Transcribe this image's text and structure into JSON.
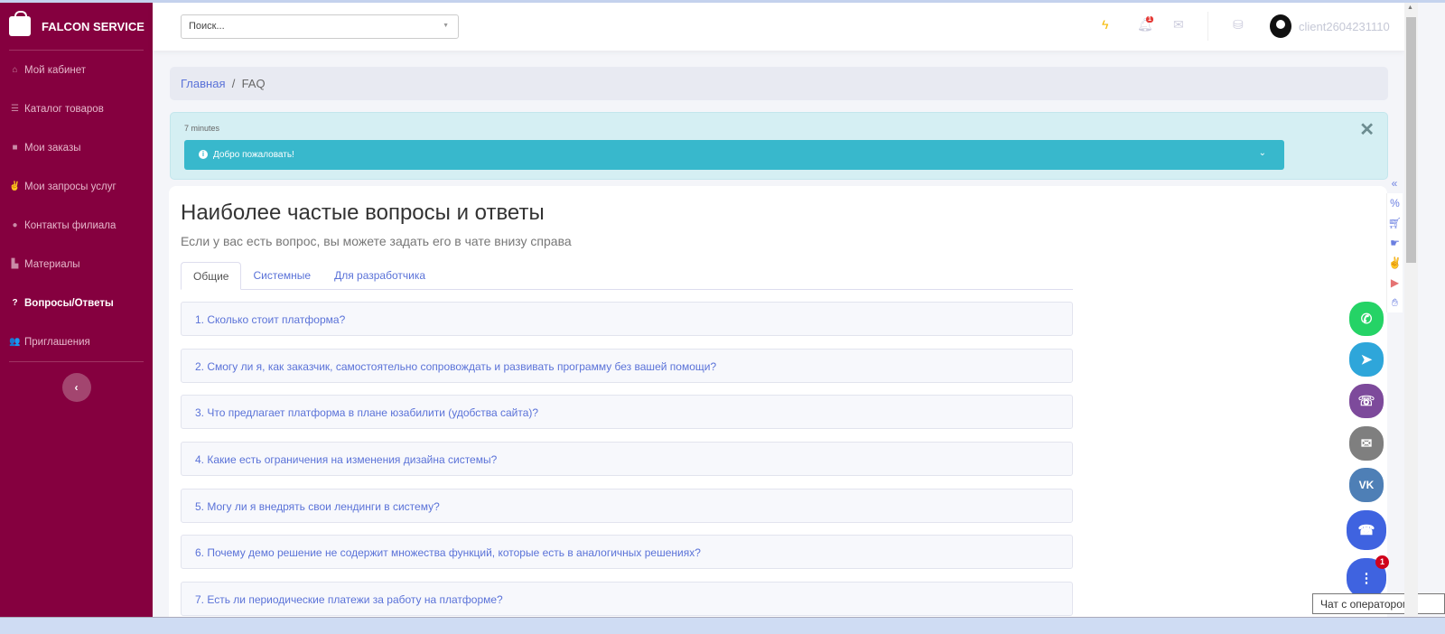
{
  "brand": "FALCON SERVICE",
  "sidebar": {
    "items": [
      {
        "label": "Мой кабинет",
        "icon": "home-icon"
      },
      {
        "label": "Каталог товаров",
        "icon": "list-icon"
      },
      {
        "label": "Мои заказы",
        "icon": "bag-icon"
      },
      {
        "label": "Мои запросы услуг",
        "icon": "hand-icon"
      },
      {
        "label": "Контакты филиала",
        "icon": "info-icon"
      },
      {
        "label": "Материалы",
        "icon": "materials-icon"
      },
      {
        "label": "Вопросы/Ответы",
        "icon": "question-icon",
        "active": true
      },
      {
        "label": "Приглашения",
        "icon": "users-icon"
      }
    ]
  },
  "header": {
    "search_placeholder": "Поиск...",
    "notifications_count": "1",
    "username": "client2604231110"
  },
  "breadcrumb": {
    "home": "Главная",
    "sep": "/",
    "current": "FAQ"
  },
  "alert": {
    "time": "7 minutes",
    "message": "Добро пожаловать!"
  },
  "main": {
    "title": "Наиболее частые вопросы и ответы",
    "subtitle": "Если у вас есть вопрос, вы можете задать его в чате внизу справа",
    "tabs": [
      "Общие",
      "Системные",
      "Для разработчика"
    ],
    "questions": [
      "1. Сколько стоит платформа?",
      "2. Смогу ли я, как заказчик, самостоятельно сопровождать и развивать программу без вашей помощи?",
      "3. Что предлагает платформа в плане юзабилити (удобства сайта)?",
      "4. Какие есть ограничения на изменения дизайна системы?",
      "5. Могу ли я внедрять свои лендинги в систему?",
      "6. Почему демо решение не содержит множества функций, которые есть в аналогичных решениях?",
      "7. Есть ли периодические платежи за работу на платформе?"
    ]
  },
  "chat": {
    "badge": "1",
    "tooltip": "Чат с оператором"
  },
  "colors": {
    "sidebar": "#85003f",
    "accent": "#5a72d8",
    "alert": "#38b8cc"
  }
}
